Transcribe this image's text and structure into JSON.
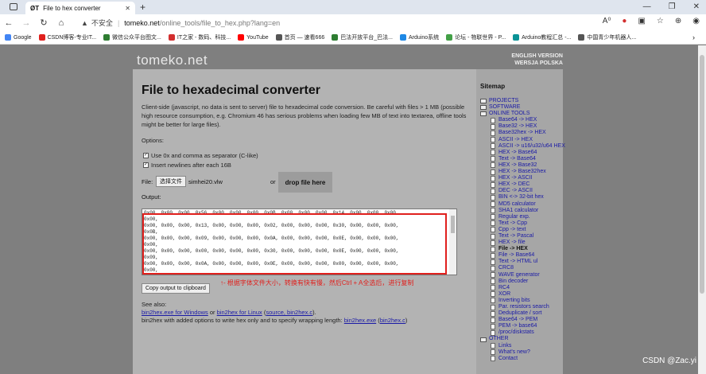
{
  "browser": {
    "tab_title": "File to hex converter",
    "tab_favicon": "ØT",
    "security": "不安全",
    "url_host": "tomeko.net",
    "url_path": "/online_tools/file_to_hex.php?lang=en",
    "bookmarks": [
      "Google",
      "CSDN博客-专业IT...",
      "微信公众平台图文...",
      "IT之家 - 数码、科技...",
      "YouTube",
      "首页 — 速看666",
      "巴法开放平台_巴法...",
      "Arduino系统",
      "论坛 - 物联世界 - P...",
      "Arduino教程汇总 -...",
      "中国青少年机器人..."
    ],
    "bookmark_colors": [
      "#4285f4",
      "#e0201d",
      "#2e7d32",
      "#d32f2f",
      "#ff0000",
      "#555",
      "#2e7d32",
      "#1e88e5",
      "#43a047",
      "#0a9396",
      "#555"
    ]
  },
  "site": {
    "logo": "tomeko.net",
    "lang_en": "ENGLISH VERSION",
    "lang_pl": "WERSJA POLSKA"
  },
  "main": {
    "title": "File to hexadecimal converter",
    "description": "Client-side (javascript, no data is sent to server) file to hexadecimal code conversion. Be careful with files > 1 MB (possible high resource consumption, e.g. Chromium 46 has serious problems when loading few MB of text into textarea, offline tools might be better for large files).",
    "options_label": "Options:",
    "opt1": "Use 0x and comma as separator (C-like)",
    "opt2": "Insert newlines after each 16B",
    "file_label": "File:",
    "file_button": "选择文件",
    "file_name": "simhei20.vlw",
    "or": "or",
    "drop": "drop file here",
    "output_label": "Output:",
    "output_text": "0x00, 0x00, 0x00, 0x56, 0x00, 0x00, 0x00, 0x0B, 0x00, 0x00, 0x00, 0x14, 0x00, 0x00, 0x00,\n0x00,\n0x00, 0x00, 0x00, 0x13, 0x00, 0x00, 0x00, 0x02, 0x00, 0x00, 0x00, 0x30, 0x00, 0x00, 0x00,\n0x0B,\n0x00, 0x00, 0x00, 0x09, 0x00, 0x00, 0x00, 0x0A, 0x00, 0x00, 0x00, 0x0E, 0x00, 0x00, 0x00,\n0x00,\n0x00, 0x00, 0x00, 0x00, 0x00, 0x00, 0x00, 0x30, 0x00, 0x00, 0x00, 0x0E, 0x00, 0x00, 0x00,\n0x09,\n0x00, 0x00, 0x00, 0x0A, 0x00, 0x00, 0x00, 0x0E, 0x00, 0x00, 0x00, 0x00, 0x00, 0x00, 0x00,\n0x00,",
    "copy_button": "Copy output to clipboard",
    "note": "↑- 根据字体文件大小，转换有快有慢，然后Ctrl + A全选后，进行复制",
    "see_also": "See also:",
    "link1": "bin2hex.exe for Windows",
    "or2": "or",
    "link2": "bin2hex for Linux",
    "link3": "source, bin2hex.c",
    "line3_text": "bin2hex with added options to write hex only and to specify wrapping length:",
    "link4": "bin2hex.exe",
    "link5": "bin2hex.c"
  },
  "sitemap": {
    "title": "Sitemap",
    "items": [
      {
        "t": "PROJECTS",
        "k": "fold"
      },
      {
        "t": "SOFTWARE",
        "k": "fold"
      },
      {
        "t": "ONLINE TOOLS",
        "k": "fold"
      },
      {
        "t": "Base64 -> HEX",
        "k": "doc"
      },
      {
        "t": "Base32 -> HEX",
        "k": "doc"
      },
      {
        "t": "Base32hex -> HEX",
        "k": "doc"
      },
      {
        "t": "ASCII -> HEX",
        "k": "doc"
      },
      {
        "t": "ASCII -> u16/u32/u64 HEX",
        "k": "doc"
      },
      {
        "t": "HEX -> Base64",
        "k": "doc"
      },
      {
        "t": "Text -> Base64",
        "k": "doc"
      },
      {
        "t": "HEX -> Base32",
        "k": "doc"
      },
      {
        "t": "HEX -> Base32hex",
        "k": "doc"
      },
      {
        "t": "HEX -> ASCII",
        "k": "doc"
      },
      {
        "t": "HEX -> DEC",
        "k": "doc"
      },
      {
        "t": "DEC -> ASCII",
        "k": "doc"
      },
      {
        "t": "BIN <-> 32-bit hex",
        "k": "doc"
      },
      {
        "t": "MD5 calculator",
        "k": "doc"
      },
      {
        "t": "SHA1 calculator",
        "k": "doc"
      },
      {
        "t": "Regular exp.",
        "k": "doc"
      },
      {
        "t": "Text -> Cpp",
        "k": "doc"
      },
      {
        "t": "Cpp -> text",
        "k": "doc"
      },
      {
        "t": "Text -> Pascal",
        "k": "doc"
      },
      {
        "t": "HEX -> file",
        "k": "doc"
      },
      {
        "t": "File -> HEX",
        "k": "cur"
      },
      {
        "t": "File -> Base64",
        "k": "doc"
      },
      {
        "t": "Text -> HTML ul",
        "k": "doc"
      },
      {
        "t": "CRC8",
        "k": "doc"
      },
      {
        "t": "WAVE generator",
        "k": "doc"
      },
      {
        "t": "Bin decoder",
        "k": "doc"
      },
      {
        "t": "RC4",
        "k": "doc"
      },
      {
        "t": "XOR",
        "k": "doc"
      },
      {
        "t": "Inverting bits",
        "k": "doc"
      },
      {
        "t": "Par. resistors search",
        "k": "doc"
      },
      {
        "t": "Deduplicate / sort",
        "k": "doc"
      },
      {
        "t": "Base64 -> PEM",
        "k": "doc"
      },
      {
        "t": "PEM -> base64",
        "k": "doc"
      },
      {
        "t": "/proc/diskstats",
        "k": "doc"
      },
      {
        "t": "OTHER",
        "k": "fold"
      },
      {
        "t": "Links",
        "k": "doc"
      },
      {
        "t": "What's new?",
        "k": "doc"
      },
      {
        "t": "Contact",
        "k": "doc"
      }
    ]
  },
  "watermark": "CSDN @Zac.yi"
}
